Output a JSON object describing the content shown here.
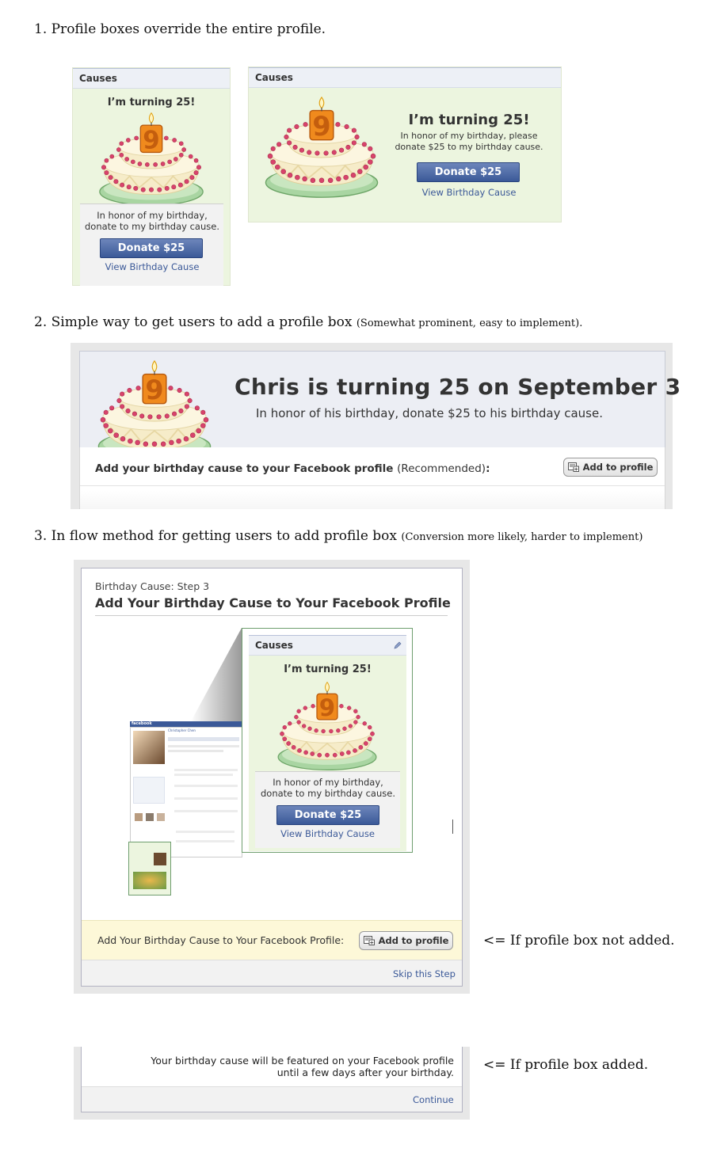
{
  "section1": {
    "heading": "1. Profile boxes override the entire profile.",
    "narrow_box": {
      "header": "Causes",
      "turning": "I’m turning 25!",
      "honor": "In honor of my birthday, donate to my birthday cause.",
      "donate": "Donate $25",
      "view_link": "View Birthday Cause"
    },
    "wide_box": {
      "header": "Causes",
      "turning": "I’m turning 25!",
      "honor": "In honor of my birthday, please donate $25 to my birthday cause.",
      "donate": "Donate $25",
      "view_link": "View Birthday Cause"
    }
  },
  "section2": {
    "heading": "2. Simple way to get users to add a profile box",
    "heading_note": "(Somewhat prominent, easy to implement).",
    "title": "Chris is turning 25 on September 3",
    "subtitle": "In honor of his birthday, donate $25 to his birthday cause.",
    "add_text": "Add your birthday cause to your Facebook profile",
    "add_text_note": "(Recommended)",
    "add_text_colon": ":",
    "add_button": "Add to profile"
  },
  "section3": {
    "heading": "3. In flow method for getting users to add profile box",
    "heading_note": "(Conversion more likely, harder to implement)",
    "step_label": "Birthday Cause: Step 3",
    "dialog_title": "Add Your Birthday Cause to Your Facebook Profile",
    "preview_box": {
      "header": "Causes",
      "turning": "I’m turning 25!",
      "honor": "In honor of my birthday, donate to my birthday cause.",
      "donate": "Donate $25",
      "view_link": "View Birthday Cause"
    },
    "yellow_text": "Add Your Birthday Cause to Your Facebook Profile:",
    "add_button": "Add to profile",
    "skip_link": "Skip this Step",
    "note_not_added": "<= If profile box not added.",
    "featured_text_line1": "Your birthday cause will be featured on your Facebook profile",
    "featured_text_line2": "until a few days after your birthday.",
    "continue_link": "Continue",
    "note_added": "<= If profile box added."
  },
  "mini_profile": {
    "logo": "facebook",
    "name": "Christopher Chen"
  },
  "colors": {
    "fb_blue": "#3b5998",
    "box_green": "#ecf5df",
    "header_gray": "#edf0f6",
    "yellow": "#fdf8d8",
    "cake_pink": "#d8436b",
    "candle_orange": "#f08a1d"
  }
}
